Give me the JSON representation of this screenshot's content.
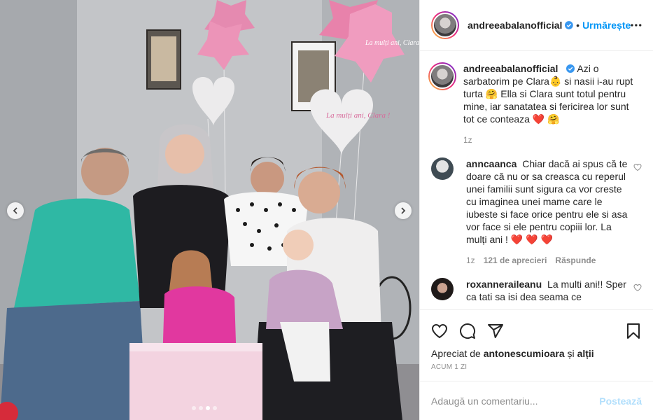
{
  "post": {
    "author": "andreeabalanofficial",
    "follow_label": "Urmărește",
    "separator": "•",
    "caption": "Azi o sarbatorim pe Clara👶 si nasii i-au rupt turta 🤗 Ella si Clara sunt totul pentru mine, iar sanatatea si fericirea lor sunt tot ce conteaza ❤️ 🤗",
    "caption_age": "1z"
  },
  "comments": [
    {
      "user": "anncaanca",
      "text": "Chiar dacă ai spus că te doare că nu or sa creasca cu reperul unei familii sunt sigura ca vor creste cu imaginea unei mame care le iubeste si face orice pentru ele si asa vor face si ele pentru copiii lor. La mulți ani ! ❤️ ❤️ ❤️",
      "age": "1z",
      "likes": "121 de aprecieri",
      "reply": "Răspunde"
    },
    {
      "user": "roxanneraileanu",
      "text": "La multi ani!! Sper ca tati sa isi dea seama ce",
      "age": "",
      "likes": "",
      "reply": ""
    }
  ],
  "likes": {
    "prefix": "Apreciat de",
    "user": "antonescumioara",
    "conj": "și",
    "others": "alții"
  },
  "timestamp": "ACUM 1 ZI",
  "add_comment": {
    "placeholder": "Adaugă un comentariu...",
    "post_label": "Postează"
  },
  "carousel": {
    "slide_count": 4,
    "active_index": 2,
    "balloon_text_1": "La mulți ani, Clara !",
    "balloon_text_2": "La mulți ani, Clara !"
  },
  "icons": [
    "chevron-left-icon",
    "chevron-right-icon",
    "verified-icon",
    "more-icon",
    "heart-icon",
    "comment-icon",
    "share-icon",
    "bookmark-icon"
  ],
  "colors": {
    "accent": "#0095f6",
    "post_disabled": "#b2dffc",
    "muted": "#8e8e8e",
    "like_red": "#ed4956"
  }
}
